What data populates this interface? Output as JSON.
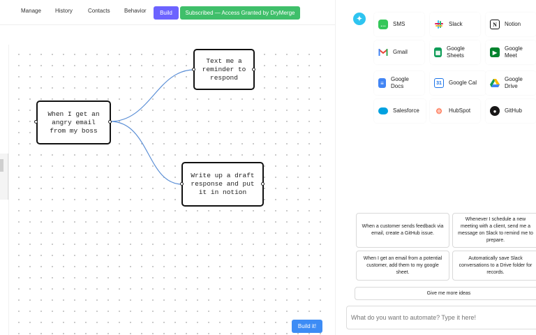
{
  "nav": {
    "items": [
      "Manage",
      "History",
      "Contacts",
      "Behavior"
    ],
    "build_label": "Build",
    "subscribed_label": "Subscribed — Access Granted by DryMerge"
  },
  "canvas": {
    "nodes": [
      {
        "id": "trigger",
        "text": "When I get an\nangry email\nfrom my boss"
      },
      {
        "id": "action1",
        "text": "Text me a\nreminder to\nrespond"
      },
      {
        "id": "action2",
        "text": "Write up a draft\nresponse and put\nit in notion"
      }
    ],
    "build_it_label": "Build it!"
  },
  "apps": [
    {
      "label": "SMS",
      "icon": "sms-icon",
      "color": "#34c759"
    },
    {
      "label": "Slack",
      "icon": "slack-icon",
      "color": "#e01e5a"
    },
    {
      "label": "Notion",
      "icon": "notion-icon",
      "color": "#111111"
    },
    {
      "label": "Gmail",
      "icon": "gmail-icon",
      "color": "#ea4335"
    },
    {
      "label": "Google\nSheets",
      "icon": "google-sheets-icon",
      "color": "#0f9d58"
    },
    {
      "label": "Google\nMeet",
      "icon": "google-meet-icon",
      "color": "#00832d"
    },
    {
      "label": "Google\nDocs",
      "icon": "google-docs-icon",
      "color": "#4285f4"
    },
    {
      "label": "Google Cal",
      "icon": "google-calendar-icon",
      "color": "#1a73e8"
    },
    {
      "label": "Google\nDrive",
      "icon": "google-drive-icon",
      "color": "#fbbc04"
    },
    {
      "label": "Salesforce",
      "icon": "salesforce-icon",
      "color": "#00a1e0"
    },
    {
      "label": "HubSpot",
      "icon": "hubspot-icon",
      "color": "#ff7a59"
    },
    {
      "label": "GitHub",
      "icon": "github-icon",
      "color": "#181717"
    }
  ],
  "ideas": [
    "When a customer sends feedback via email, create a GitHub issue.",
    "Whenever I schedule a new meeting with a client, send me a message on Slack to remind me to prepare.",
    "When I get an email from a potential customer, add them to my google sheet.",
    "Automatically save Slack conversations to a Drive folder for records."
  ],
  "more_ideas_label": "Give me more ideas",
  "automate_placeholder": "What do you want to automate? Type it here!",
  "colors": {
    "build": "#6c63ff",
    "subscribed": "#3fbf6a",
    "build_it": "#3d8cf5",
    "edge": "#5b8fd6"
  }
}
